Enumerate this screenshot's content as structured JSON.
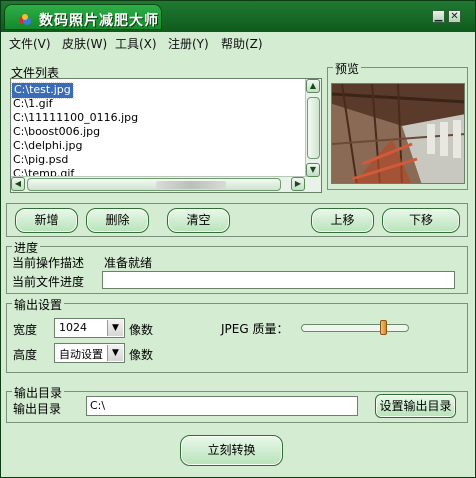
{
  "window": {
    "title": "数码照片减肥大师"
  },
  "menu": [
    "文件(V)",
    "皮肤(W)",
    "工具(X)",
    "注册(Y)",
    "帮助(Z)"
  ],
  "file_list": {
    "label": "文件列表",
    "items": [
      "C:\\test.jpg",
      "C:\\1.gif",
      "C:\\11111100_0116.jpg",
      "C:\\boost006.jpg",
      "C:\\delphi.jpg",
      "C:\\pig.psd",
      "C:\\temp.gif"
    ],
    "selected_index": 0
  },
  "preview": {
    "label": "预览"
  },
  "actions": {
    "add": "新增",
    "delete": "删除",
    "clear": "清空",
    "move_up": "上移",
    "move_down": "下移"
  },
  "progress": {
    "label": "进度",
    "operation_label": "当前操作描述",
    "operation_value": "准备就绪",
    "file_progress_label": "当前文件进度"
  },
  "output_settings": {
    "label": "输出设置",
    "width_label": "宽度",
    "width_value": "1024",
    "height_label": "高度",
    "height_value": "自动设置",
    "unit": "像数",
    "jpeg_quality_label": "JPEG 质量：",
    "jpeg_quality_level": 0.78
  },
  "output_dir": {
    "label": "输出目录",
    "field_label": "输出目录",
    "value": "C:\\",
    "set_button": "设置输出目录"
  },
  "convert_button": "立刻转换",
  "colors": {
    "window_bg": "#d4ecd2",
    "title_bar": "#138a2a",
    "selection": "#3a6db5"
  }
}
